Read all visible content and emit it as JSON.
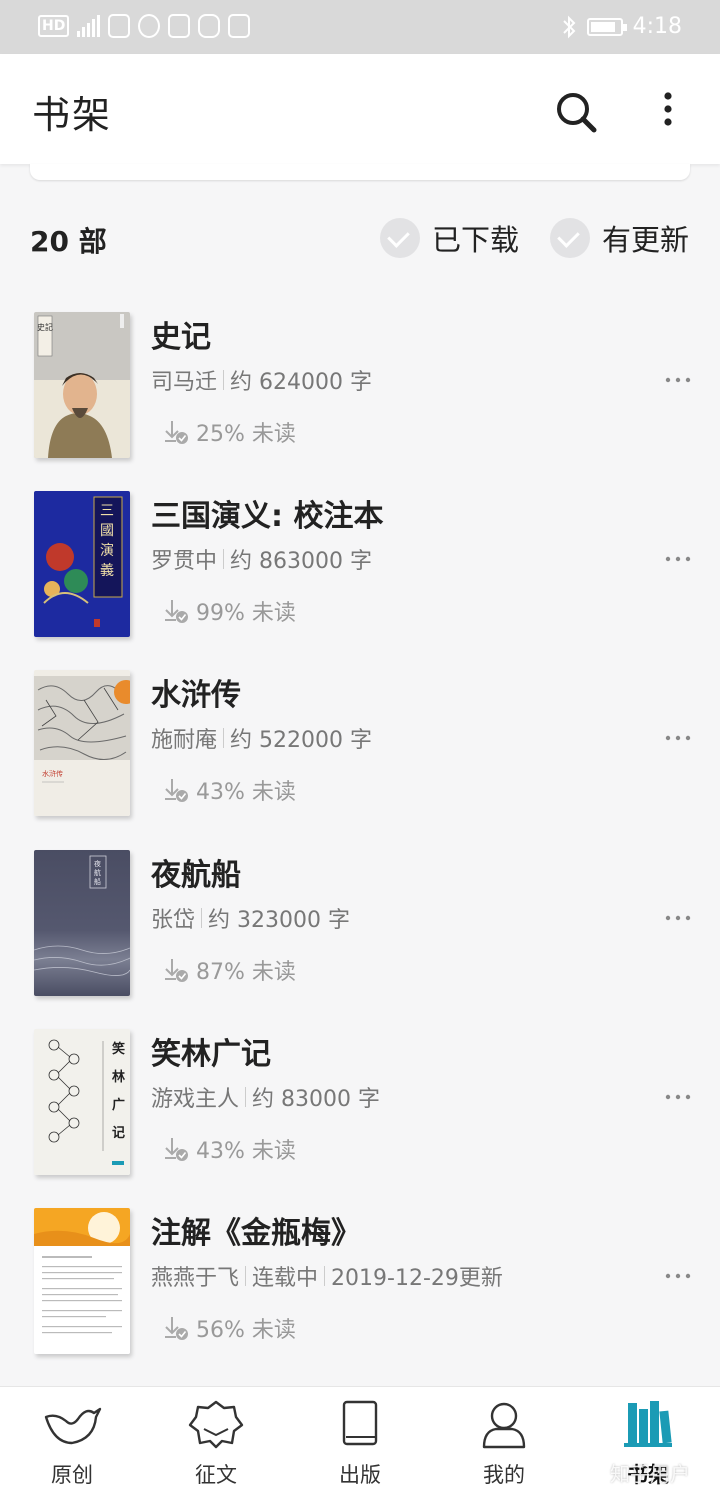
{
  "status_bar": {
    "time": "4:18",
    "hd": "HD"
  },
  "app_bar": {
    "title": "书架"
  },
  "filters": {
    "count": "20 部",
    "downloaded": "已下载",
    "updated": "有更新"
  },
  "books": [
    {
      "title": "史记",
      "author": "司马迁",
      "info": "约 624000 字",
      "progress": "25% 未读"
    },
    {
      "title": "三国演义: 校注本",
      "author": "罗贯中",
      "info": "约 863000 字",
      "progress": "99% 未读"
    },
    {
      "title": "水浒传",
      "author": "施耐庵",
      "info": "约 522000 字",
      "progress": "43% 未读"
    },
    {
      "title": "夜航船",
      "author": "张岱",
      "info": "约 323000 字",
      "progress": "87% 未读"
    },
    {
      "title": "笑林广记",
      "author": "游戏主人",
      "info": "约 83000 字",
      "progress": "43% 未读"
    },
    {
      "title": "注解《金瓶梅》",
      "author": "燕燕于飞",
      "info": "连载中",
      "update": "2019-12-29更新",
      "progress": "56% 未读"
    }
  ],
  "covers": {
    "shiji_text": "史記",
    "sanguo_text": "三國演義",
    "xiaolin_text": "笑林广记"
  },
  "bottom_nav": [
    {
      "label": "原创",
      "icon": "bird-icon"
    },
    {
      "label": "征文",
      "icon": "badge-icon"
    },
    {
      "label": "出版",
      "icon": "book-icon"
    },
    {
      "label": "我的",
      "icon": "person-icon"
    },
    {
      "label": "书架",
      "icon": "bookshelf-icon",
      "active": true
    }
  ],
  "watermark": "知乎用户",
  "colors": {
    "accent": "#1b9bb5",
    "background": "#f6f6f7"
  }
}
